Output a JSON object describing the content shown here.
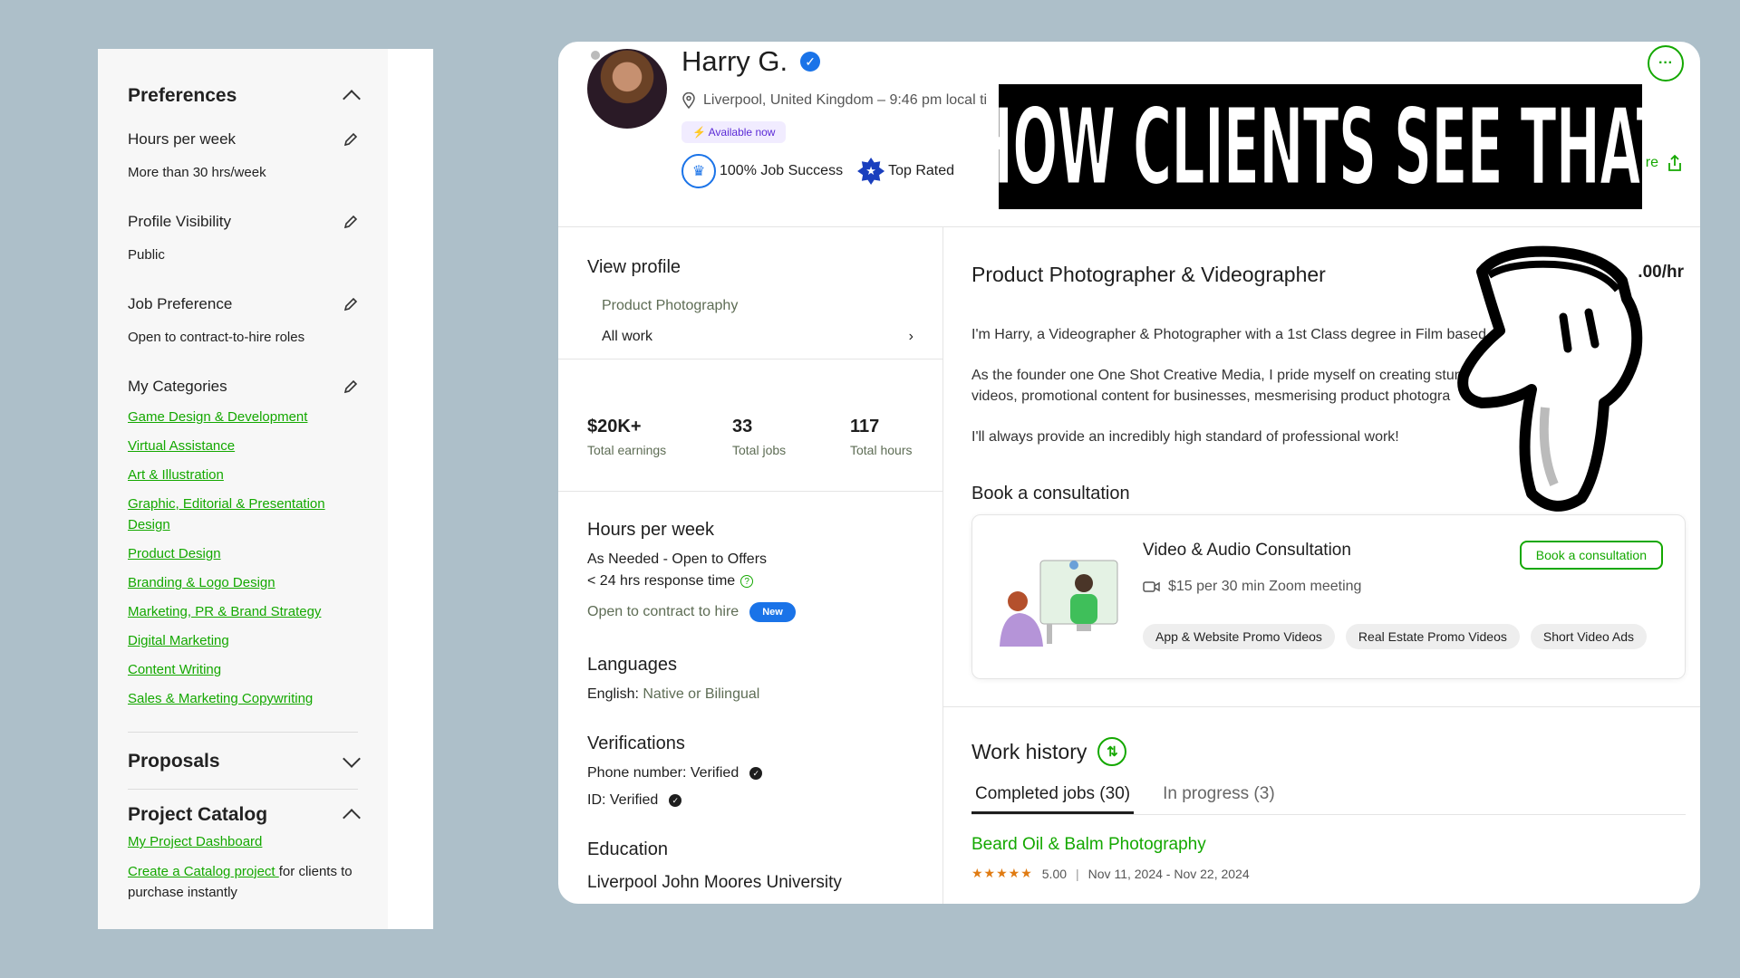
{
  "left_panel": {
    "preferences_title": "Preferences",
    "rows": [
      {
        "label": "Hours per week",
        "value": "More than 30 hrs/week"
      },
      {
        "label": "Profile Visibility",
        "value": "Public"
      },
      {
        "label": "Job Preference",
        "value": "Open to contract-to-hire roles"
      }
    ],
    "categories_label": "My Categories",
    "categories": [
      "Game Design & Development",
      "Virtual Assistance",
      "Art & Illustration",
      "Graphic, Editorial & Presentation Design",
      "Product Design",
      "Branding & Logo Design",
      "Marketing, PR & Brand Strategy",
      "Digital Marketing",
      "Content Writing",
      "Sales & Marketing Copywriting"
    ],
    "proposals_title": "Proposals",
    "catalog_title": "Project Catalog",
    "dashboard_link": "My Project Dashboard",
    "create_link": "Create a Catalog project ",
    "create_rest": "for clients to purchase instantly"
  },
  "profile": {
    "name": "Harry G.",
    "location": "Liverpool, United Kingdom – 9:46 pm local ti",
    "available": "Available now",
    "job_success": "100% Job Success",
    "top_rated": "Top Rated",
    "share_label": "re"
  },
  "sidebar": {
    "view_profile": "View profile",
    "specialty": "Product Photography",
    "all_work": "All work",
    "stats": [
      {
        "value": "$20K+",
        "label": "Total earnings"
      },
      {
        "value": "33",
        "label": "Total jobs"
      },
      {
        "value": "117",
        "label": "Total hours"
      }
    ],
    "hours_title": "Hours per week",
    "hours_value": "As Needed - Open to Offers",
    "response": "< 24 hrs response time",
    "contract": "Open to contract to hire",
    "new_badge": "New",
    "languages_title": "Languages",
    "language_name": "English:",
    "language_level": " Native or Bilingual",
    "verifications_title": "Verifications",
    "phone": "Phone number: Verified",
    "id": "ID: Verified",
    "education_title": "Education",
    "university": "Liverpool John Moores University"
  },
  "main": {
    "title": "Product Photographer & Videographer",
    "rate": ".00/hr",
    "bio1": "I'm Harry, a Videographer & Photographer with a 1st Class degree in Film based",
    "bio2a": "As the founder one One Shot Creative Media, I pride myself on creating stun",
    "bio2b": "videos, promotional content for businesses, mesmerising product photogra",
    "bio3": "I'll always provide an incredibly high standard of professional work!",
    "consult_title": "Book a consultation",
    "card_title": "Video & Audio Consultation",
    "card_price": "$15 per 30 min Zoom meeting",
    "book_button": "Book a consultation",
    "tags": [
      "App & Website Promo Videos",
      "Real Estate Promo Videos",
      "Short Video Ads"
    ],
    "work_history": "Work history",
    "tab_completed": "Completed jobs (30)",
    "tab_progress": "In progress (3)",
    "job_title": "Beard Oil & Balm Photography",
    "job_rating": "5.00",
    "job_dates": "Nov 11, 2024 - Nov 22, 2024"
  },
  "overlay": {
    "caption": "HOW CLIENTS SEE THAT"
  },
  "colors": {
    "accent": "#14a800",
    "blue": "#1a73e8",
    "background": "#adbfc9"
  }
}
